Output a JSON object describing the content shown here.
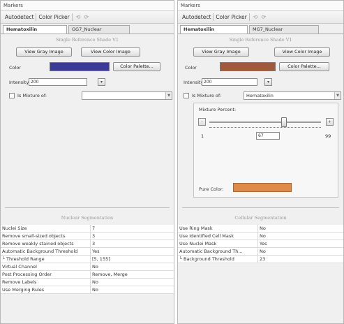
{
  "left": {
    "title": "Markers",
    "toolbar": {
      "autodetect": "Autodetect",
      "color_picker": "Color Picker",
      "undo_icon": "undo-icon",
      "redo_icon": "redo-icon"
    },
    "tabs": [
      "Hematoxilin",
      "GG7_Nuclear"
    ],
    "section": "Single Reference Shade V1",
    "view_gray": "View Gray Image",
    "view_color": "View Color Image",
    "color_label": "Color",
    "color_value": "#3b3b95",
    "palette_button": "Color Palette...",
    "intensity_label": "Intensity",
    "intensity_value": "200",
    "mixture_label": "Is Mixture of:",
    "mixture_value": "",
    "segmentation_title": "Nuclear Segmentation",
    "properties": [
      [
        "Nuclei Size",
        "7"
      ],
      [
        "Remove small-sized objects",
        "3"
      ],
      [
        "Remove weakly stained objects",
        "3"
      ],
      [
        "Automatic Background Threshold",
        "Yes"
      ],
      [
        "└ Threshold Range",
        "[5, 155]"
      ],
      [
        "Virtual Channel",
        "No"
      ],
      [
        "Post Processing Order",
        "Remove, Merge"
      ],
      [
        "Remove Labels",
        "No"
      ],
      [
        "Use Merging Rules",
        "No"
      ]
    ]
  },
  "right": {
    "title": "Markers",
    "toolbar": {
      "autodetect": "Autodetect",
      "color_picker": "Color Picker",
      "undo_icon": "undo-icon",
      "redo_icon": "redo-icon"
    },
    "tabs": [
      "Hematoxilin",
      "MG7_Nuclear"
    ],
    "section": "Single Reference Shade V1",
    "view_gray": "View Gray Image",
    "view_color": "View Color Image",
    "color_label": "Color",
    "color_value": "#a05a3c",
    "palette_button": "Color Palette...",
    "intensity_label": "Intensity",
    "intensity_value": "200",
    "mixture_label": "Is Mixture of:",
    "mixture_value": "Hematoxilin",
    "mixture_percent_label": "Mixture Percent:",
    "slider_min": "1",
    "slider_max": "99",
    "slider_value": "67",
    "slider_fraction": 0.67,
    "minus": "-",
    "plus": "+",
    "pure_color_label": "Pure Color:",
    "pure_color_value": "#e08a4a",
    "segmentation_title": "Cellular Segmentation",
    "properties": [
      [
        "Use Ring Mask",
        "No"
      ],
      [
        "Use Identified Cell Mask",
        "No"
      ],
      [
        "Use Nuclei Mask",
        "Yes"
      ],
      [
        "Automatic Background Th...",
        "No"
      ],
      [
        "└ Background Threshold",
        "23"
      ]
    ]
  }
}
